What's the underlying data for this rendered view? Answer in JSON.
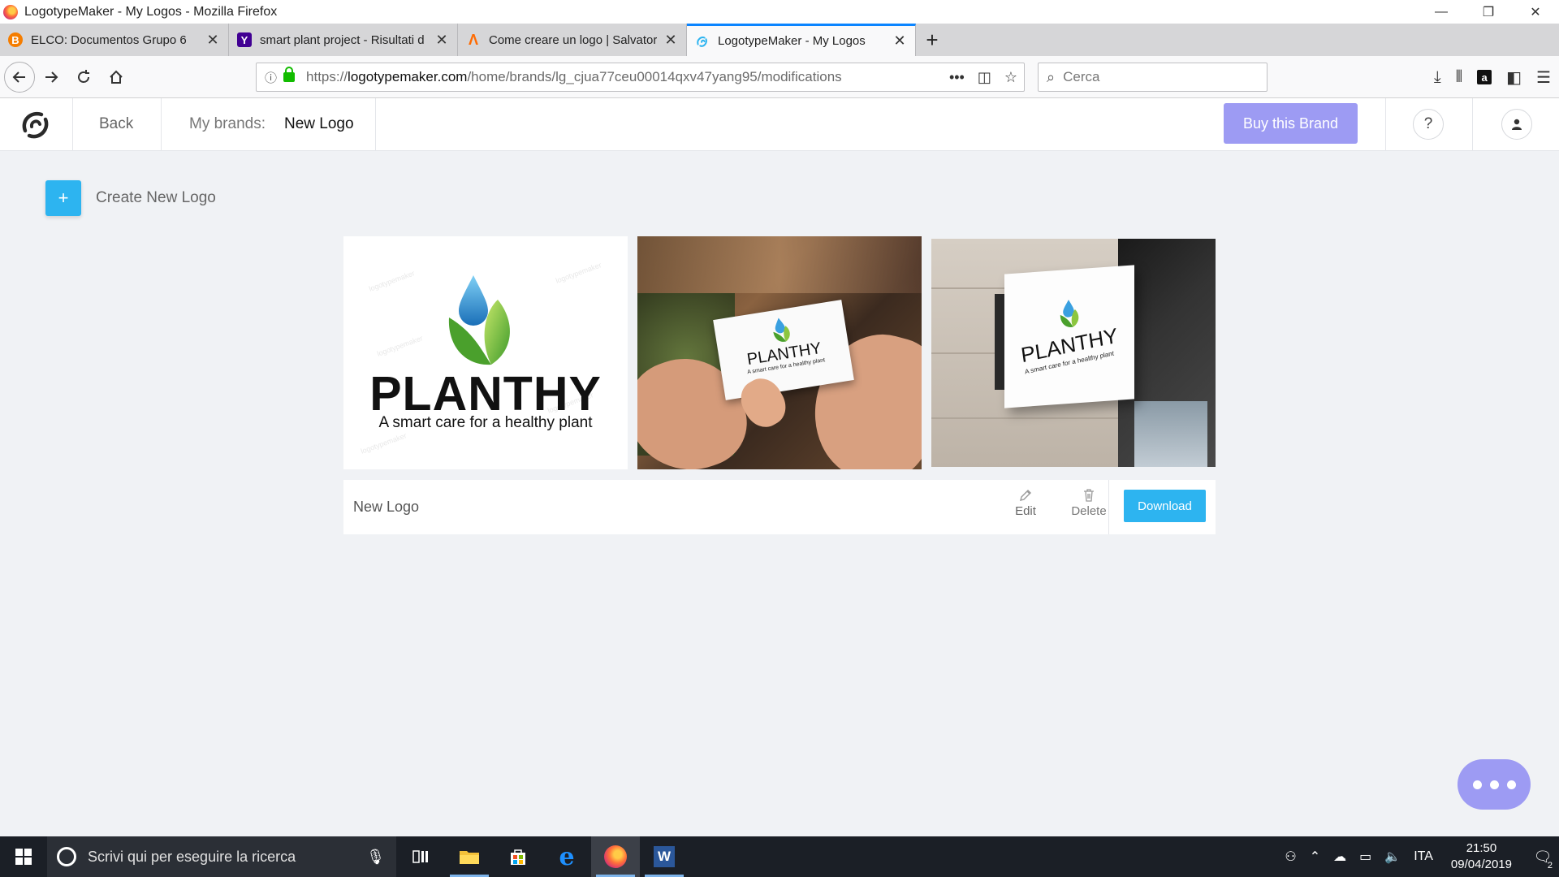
{
  "window": {
    "title": "LogotypeMaker - My Logos - Mozilla Firefox",
    "controls": {
      "minimize": "—",
      "restore": "❐",
      "close": "✕"
    }
  },
  "tabs": [
    {
      "label": "ELCO: Documentos Grupo 6",
      "icon": "blogger-icon",
      "color": "#f57d00",
      "glyph": "B",
      "active": false
    },
    {
      "label": "smart plant project - Risultati d",
      "icon": "yahoo-icon",
      "color": "#410093",
      "glyph": "Y",
      "active": false
    },
    {
      "label": "Come creare un logo | Salvator",
      "icon": "aranzulla-icon",
      "color": "#ff6a00",
      "glyph": "A",
      "active": false
    },
    {
      "label": "LogotypeMaker - My Logos",
      "icon": "logotypemaker-icon",
      "color": "#2db4f0",
      "glyph": "",
      "active": true
    }
  ],
  "navbar": {
    "url_prefix": "https://",
    "url_domain": "logotypemaker.com",
    "url_path": "/home/brands/lg_cjua77ceu00014qxv47yang95/modifications",
    "search_placeholder": "Cerca"
  },
  "app": {
    "back_label": "Back",
    "brands_label": "My brands:",
    "brands_value": "New Logo",
    "buy_label": "Buy this Brand",
    "help_label": "?",
    "create_label": "Create New Logo",
    "create_icon": "+"
  },
  "logo": {
    "brand_name": "PLANTHY",
    "slogan": "A smart care for a healthy plant",
    "card_name": "New Logo",
    "edit_label": "Edit",
    "delete_label": "Delete",
    "download_label": "Download",
    "colors": {
      "drop": "#3aa0e0",
      "leaf": "#7cc242",
      "accent": "#2db4f0",
      "brand_purple": "#9d9bf3"
    }
  },
  "taskbar": {
    "search_placeholder": "Scrivi qui per eseguire la ricerca",
    "language": "ITA",
    "time": "21:50",
    "date": "09/04/2019",
    "notifications": "2"
  }
}
